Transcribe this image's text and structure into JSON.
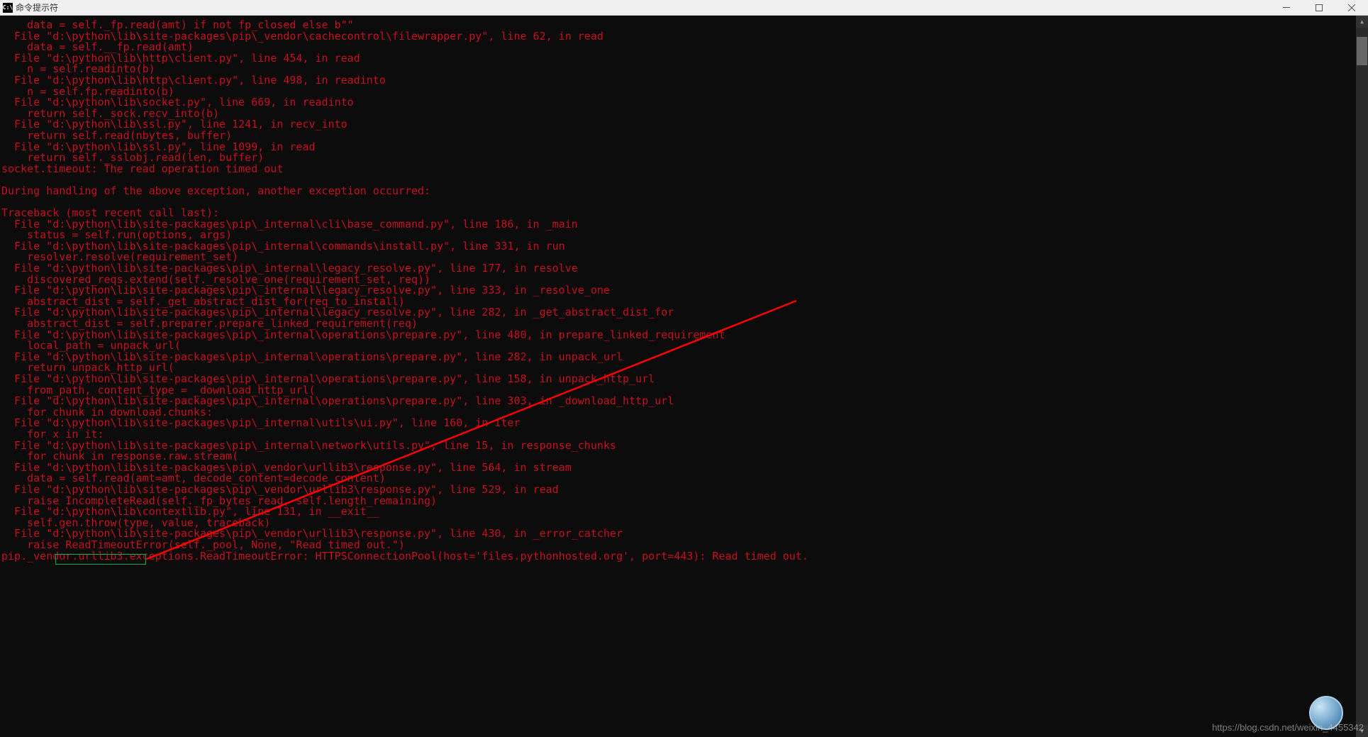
{
  "title": "命令提示符",
  "colors": {
    "error_text": "#c50f1f",
    "highlight_border": "#00b050",
    "annotation_line": "#ff0000"
  },
  "terminal_lines": [
    "    data = self._fp.read(amt) if not fp_closed else b\"\"",
    "  File \"d:\\python\\lib\\site-packages\\pip\\_vendor\\cachecontrol\\filewrapper.py\", line 62, in read",
    "    data = self.__fp.read(amt)",
    "  File \"d:\\python\\lib\\http\\client.py\", line 454, in read",
    "    n = self.readinto(b)",
    "  File \"d:\\python\\lib\\http\\client.py\", line 498, in readinto",
    "    n = self.fp.readinto(b)",
    "  File \"d:\\python\\lib\\socket.py\", line 669, in readinto",
    "    return self._sock.recv_into(b)",
    "  File \"d:\\python\\lib\\ssl.py\", line 1241, in recv_into",
    "    return self.read(nbytes, buffer)",
    "  File \"d:\\python\\lib\\ssl.py\", line 1099, in read",
    "    return self._sslobj.read(len, buffer)",
    "socket.timeout: The read operation timed out",
    "",
    "During handling of the above exception, another exception occurred:",
    "",
    "Traceback (most recent call last):",
    "  File \"d:\\python\\lib\\site-packages\\pip\\_internal\\cli\\base_command.py\", line 186, in _main",
    "    status = self.run(options, args)",
    "  File \"d:\\python\\lib\\site-packages\\pip\\_internal\\commands\\install.py\", line 331, in run",
    "    resolver.resolve(requirement_set)",
    "  File \"d:\\python\\lib\\site-packages\\pip\\_internal\\legacy_resolve.py\", line 177, in resolve",
    "    discovered_reqs.extend(self._resolve_one(requirement_set, req))",
    "  File \"d:\\python\\lib\\site-packages\\pip\\_internal\\legacy_resolve.py\", line 333, in _resolve_one",
    "    abstract_dist = self._get_abstract_dist_for(req_to_install)",
    "  File \"d:\\python\\lib\\site-packages\\pip\\_internal\\legacy_resolve.py\", line 282, in _get_abstract_dist_for",
    "    abstract_dist = self.preparer.prepare_linked_requirement(req)",
    "  File \"d:\\python\\lib\\site-packages\\pip\\_internal\\operations\\prepare.py\", line 480, in prepare_linked_requirement",
    "    local_path = unpack_url(",
    "  File \"d:\\python\\lib\\site-packages\\pip\\_internal\\operations\\prepare.py\", line 282, in unpack_url",
    "    return unpack_http_url(",
    "  File \"d:\\python\\lib\\site-packages\\pip\\_internal\\operations\\prepare.py\", line 158, in unpack_http_url",
    "    from_path, content_type = _download_http_url(",
    "  File \"d:\\python\\lib\\site-packages\\pip\\_internal\\operations\\prepare.py\", line 303, in _download_http_url",
    "    for chunk in download.chunks:",
    "  File \"d:\\python\\lib\\site-packages\\pip\\_internal\\utils\\ui.py\", line 160, in iter",
    "    for x in it:",
    "  File \"d:\\python\\lib\\site-packages\\pip\\_internal\\network\\utils.py\", line 15, in response_chunks",
    "    for chunk in response.raw.stream(",
    "  File \"d:\\python\\lib\\site-packages\\pip\\_vendor\\urllib3\\response.py\", line 564, in stream",
    "    data = self.read(amt=amt, decode_content=decode_content)",
    "  File \"d:\\python\\lib\\site-packages\\pip\\_vendor\\urllib3\\response.py\", line 529, in read",
    "    raise IncompleteRead(self._fp_bytes_read, self.length_remaining)",
    "  File \"d:\\python\\lib\\contextlib.py\", line 131, in __exit__",
    "    self.gen.throw(type, value, traceback)",
    "  File \"d:\\python\\lib\\site-packages\\pip\\_vendor\\urllib3\\response.py\", line 430, in _error_catcher",
    "    raise ReadTimeoutError(self._pool, None, \"Read timed out.\")",
    "pip._vendor.urllib3.exceptions.ReadTimeoutError: HTTPSConnectionPool(host='files.pythonhosted.org', port=443): Read timed out."
  ],
  "highlighted_text": "ReadTimeoutError",
  "watermark": "https://blog.csdn.net/weixin_4455342"
}
